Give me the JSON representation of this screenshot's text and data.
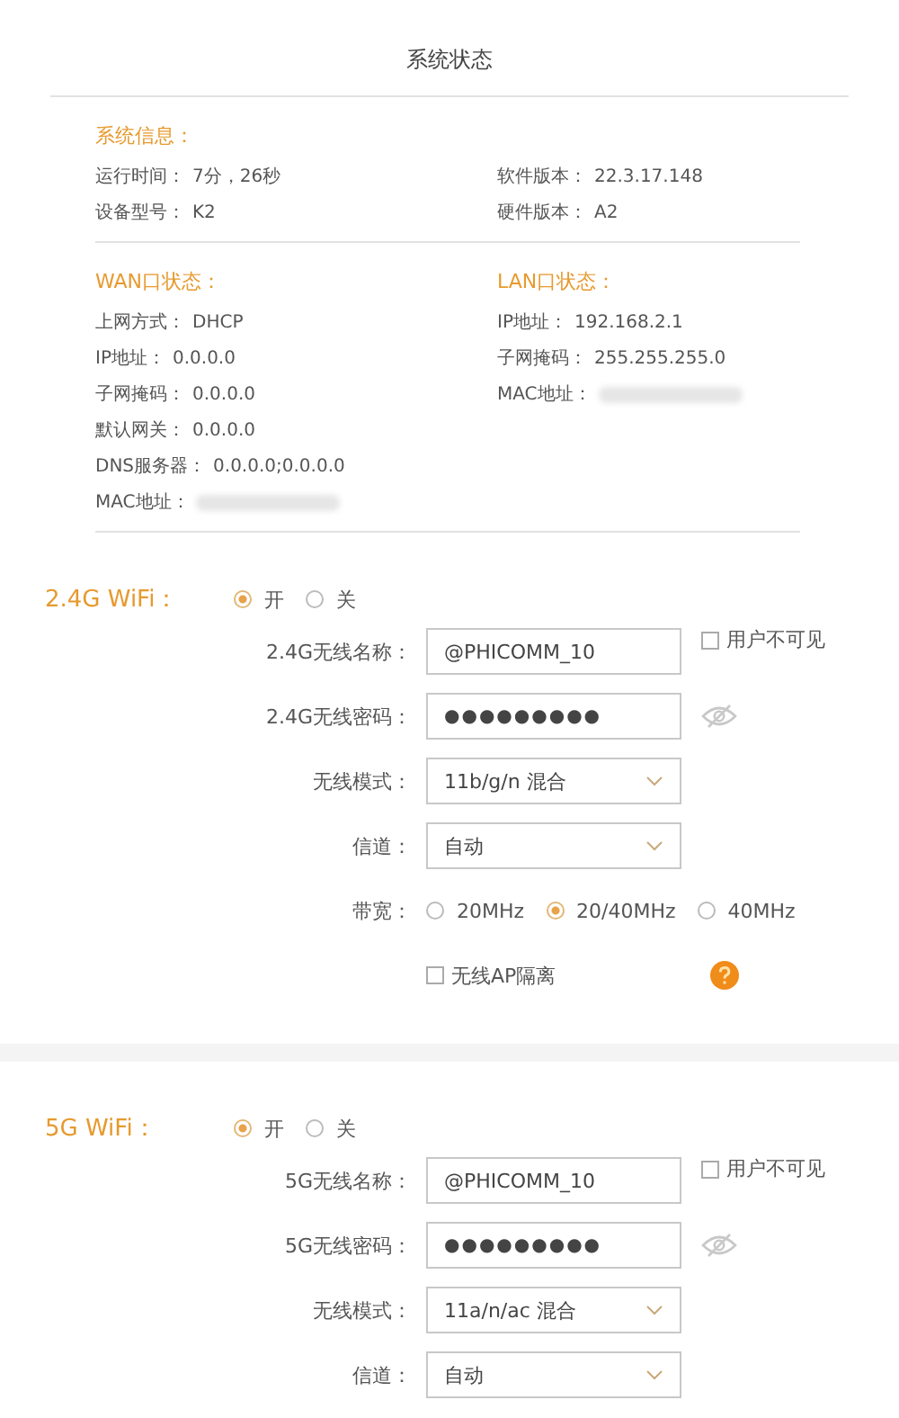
{
  "title": "系统状态",
  "system_info": {
    "heading": "系统信息：",
    "left": [
      {
        "label": "运行时间：",
        "value": "7分，26秒",
        "kind": "text"
      },
      {
        "label": "设备型号：",
        "value": "K2",
        "kind": "text"
      }
    ],
    "right": [
      {
        "label": "软件版本：",
        "value": "22.3.17.148",
        "kind": "text"
      },
      {
        "label": "硬件版本：",
        "value": "A2",
        "kind": "text"
      }
    ]
  },
  "ports": [
    {
      "heading": "WAN口状态：",
      "rows": [
        {
          "label": "上网方式：",
          "value": "DHCP",
          "kind": "text"
        },
        {
          "label": "IP地址：",
          "value": "0.0.0.0",
          "kind": "text"
        },
        {
          "label": "子网掩码：",
          "value": "0.0.0.0",
          "kind": "text"
        },
        {
          "label": "默认网关：",
          "value": "0.0.0.0",
          "kind": "text"
        },
        {
          "label": "DNS服务器：",
          "value": "0.0.0.0;0.0.0.0",
          "kind": "text"
        },
        {
          "label": "MAC地址：",
          "kind": "redacted"
        }
      ]
    },
    {
      "heading": "LAN口状态：",
      "rows": [
        {
          "label": "IP地址：",
          "value": "192.168.2.1",
          "kind": "text"
        },
        {
          "label": "子网掩码：",
          "value": "255.255.255.0",
          "kind": "text"
        },
        {
          "label": "MAC地址：",
          "kind": "redacted"
        }
      ]
    }
  ],
  "wifi_sections": [
    {
      "label": "2.4G WiFi：",
      "power": [
        {
          "label": "开",
          "selected": true
        },
        {
          "label": "关",
          "selected": false
        }
      ],
      "fields": [
        {
          "kind": "text",
          "label": "2.4G无线名称：",
          "value": "@PHICOMM_10",
          "checkbox": {
            "label": "用户不可见",
            "checked": false
          }
        },
        {
          "kind": "password",
          "label": "2.4G无线密码：",
          "value": "●●●●●●●●●"
        },
        {
          "kind": "select",
          "label": "无线模式：",
          "value": "11b/g/n 混合"
        },
        {
          "kind": "select",
          "label": "信道：",
          "value": "自动"
        },
        {
          "kind": "radio",
          "label": "带宽：",
          "options": [
            {
              "label": "20MHz",
              "selected": false
            },
            {
              "label": "20/40MHz",
              "selected": true
            },
            {
              "label": "40MHz",
              "selected": false
            }
          ]
        },
        {
          "kind": "checkbox",
          "label": "无线AP隔离",
          "checked": false
        }
      ]
    },
    {
      "label": "5G WiFi：",
      "power": [
        {
          "label": "开",
          "selected": true
        },
        {
          "label": "关",
          "selected": false
        }
      ],
      "fields": [
        {
          "kind": "text",
          "label": "5G无线名称：",
          "value": "@PHICOMM_10",
          "checkbox": {
            "label": "用户不可见",
            "checked": false
          }
        },
        {
          "kind": "password",
          "label": "5G无线密码：",
          "value": "●●●●●●●●●"
        },
        {
          "kind": "select",
          "label": "无线模式：",
          "value": "11a/n/ac 混合"
        },
        {
          "kind": "select",
          "label": "信道：",
          "value": "自动"
        }
      ]
    }
  ]
}
